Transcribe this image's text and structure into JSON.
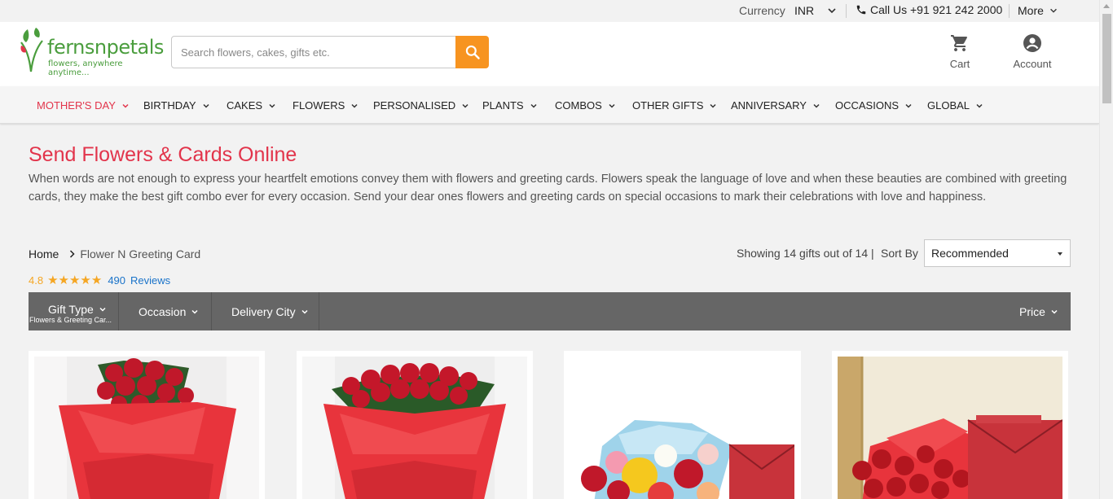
{
  "topbar": {
    "currency_label": "Currency",
    "currency_value": "INR",
    "call_text": "Call Us +91 921 242 2000",
    "more_label": "More"
  },
  "header": {
    "logo_text": "fernsnpetals",
    "logo_tagline": "flowers, anywhere anytime...",
    "search_placeholder": "Search flowers, cakes, gifts etc.",
    "cart_label": "Cart",
    "account_label": "Account"
  },
  "nav": {
    "items": [
      {
        "label": "MOTHER'S DAY"
      },
      {
        "label": "BIRTHDAY"
      },
      {
        "label": "CAKES"
      },
      {
        "label": "FLOWERS"
      },
      {
        "label": "PERSONALISED"
      },
      {
        "label": "PLANTS"
      },
      {
        "label": "COMBOS"
      },
      {
        "label": "OTHER GIFTS"
      },
      {
        "label": "ANNIVERSARY"
      },
      {
        "label": "OCCASIONS"
      },
      {
        "label": "GLOBAL"
      }
    ]
  },
  "page": {
    "title": "Send Flowers & Cards Online",
    "description": "When words are not enough to express your heartfelt emotions convey them with flowers and greeting cards. Flowers speak the language of love and when these beauties are combined with greeting cards, they make the best gift combo ever for every occasion. Send your dear ones flowers and greeting cards on special occasions to mark their celebrations with love and happiness."
  },
  "breadcrumb": {
    "home": "Home",
    "current": "Flower N Greeting Card"
  },
  "rating": {
    "value": "4.8",
    "stars": "★★★★★",
    "count": "490",
    "label": "Reviews"
  },
  "listing": {
    "showing_text": "Showing 14 gifts out of 14 |",
    "sort_label": "Sort By",
    "sort_value": "Recommended"
  },
  "filters": {
    "gift_type": "Gift Type",
    "gift_type_sub": "Flowers & Greeting Car...",
    "occasion": "Occasion",
    "delivery_city": "Delivery City",
    "price": "Price"
  },
  "colors": {
    "brand_red": "#e2344b",
    "search_orange": "#f79420",
    "logo_green": "#4a9d3d",
    "filter_bar": "#666666",
    "star": "#f5a623",
    "link_blue": "#1a73c9"
  }
}
